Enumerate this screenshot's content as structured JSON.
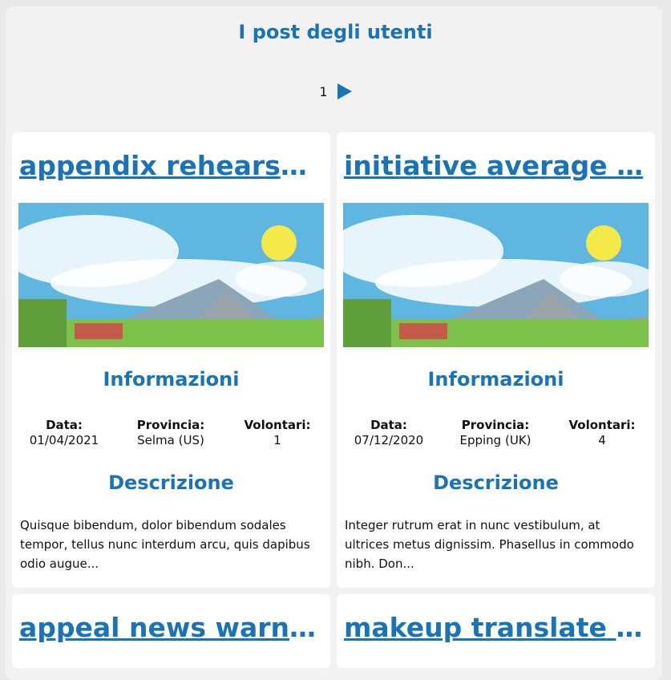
{
  "page": {
    "title": "I post degli utenti",
    "accent_color": "#1a73b8"
  },
  "pagination": {
    "current_page": "1",
    "next_icon": "next-arrow-icon"
  },
  "labels": {
    "info_heading": "Informazioni",
    "desc_heading": "Descrizione",
    "date": "Data:",
    "province": "Provincia:",
    "volunteers": "Volontari:"
  },
  "posts": [
    {
      "title": "appendix rehearsal…",
      "date": "01/04/2021",
      "province": "Selma (US)",
      "volunteers": "1",
      "description": "Quisque bibendum, dolor bibendum sodales tempor, tellus nunc interdum arcu, quis dapibus odio augue..."
    },
    {
      "title": "initiative average …",
      "date": "07/12/2020",
      "province": "Epping (UK)",
      "volunteers": "4",
      "description": "Integer rutrum erat in nunc vestibulum, at ultrices metus dignissim. Phasellus in commodo nibh. Don..."
    },
    {
      "title": "appeal news warni…"
    },
    {
      "title": "makeup translate c…"
    }
  ]
}
